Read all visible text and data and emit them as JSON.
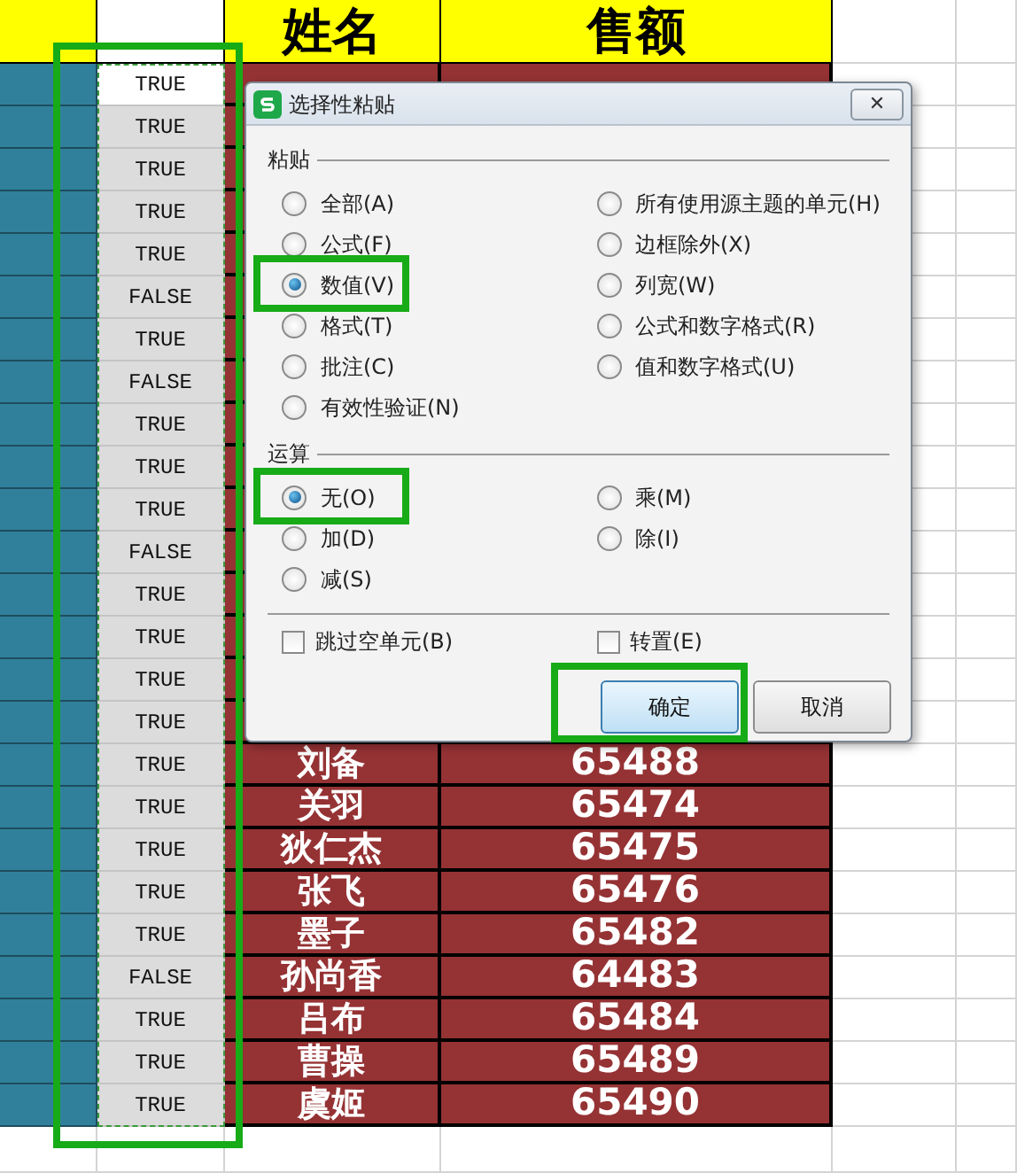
{
  "sheet": {
    "headers": [
      "姓名",
      "售额"
    ],
    "column_2_highlighted": true,
    "rows": [
      {
        "column_2": "TRUE",
        "active": true
      },
      {
        "column_2": "TRUE",
        "active": false
      },
      {
        "column_2": "TRUE",
        "active": false
      },
      {
        "column_2": "TRUE",
        "active": false
      },
      {
        "column_2": "TRUE",
        "active": false
      },
      {
        "column_2": "FALSE",
        "active": false
      },
      {
        "column_2": "TRUE",
        "active": false
      },
      {
        "column_2": "FALSE",
        "active": false
      },
      {
        "column_2": "TRUE",
        "active": false
      },
      {
        "column_2": "TRUE",
        "active": false
      },
      {
        "column_2": "TRUE",
        "active": false
      },
      {
        "column_2": "FALSE",
        "active": false
      },
      {
        "column_2": "TRUE",
        "active": false
      },
      {
        "column_2": "TRUE",
        "active": false
      },
      {
        "column_2": "TRUE",
        "active": false
      },
      {
        "column_2": "TRUE",
        "active": false
      },
      {
        "column_2": "TRUE",
        "active": false,
        "name": "刘备",
        "amount": "65488"
      },
      {
        "column_2": "TRUE",
        "active": false,
        "name": "关羽",
        "amount": "65474"
      },
      {
        "column_2": "TRUE",
        "active": false,
        "name": "狄仁杰",
        "amount": "65475"
      },
      {
        "column_2": "TRUE",
        "active": false,
        "name": "张飞",
        "amount": "65476"
      },
      {
        "column_2": "TRUE",
        "active": false,
        "name": "墨子",
        "amount": "65482"
      },
      {
        "column_2": "FALSE",
        "active": false,
        "name": "孙尚香",
        "amount": "64483"
      },
      {
        "column_2": "TRUE",
        "active": false,
        "name": "吕布",
        "amount": "65484"
      },
      {
        "column_2": "TRUE",
        "active": false,
        "name": "曹操",
        "amount": "65489"
      },
      {
        "column_2": "TRUE",
        "active": false,
        "name": "虞姬",
        "amount": "65490"
      }
    ]
  },
  "dialog": {
    "title": "选择性粘贴",
    "close": "✕",
    "paste": {
      "title": "粘贴",
      "column_1": [
        {
          "label": "全部(A)",
          "selected": false,
          "highlighted": false
        },
        {
          "label": "公式(F)",
          "selected": false,
          "highlighted": false
        },
        {
          "label": "数值(V)",
          "selected": true,
          "highlighted": true
        },
        {
          "label": "格式(T)",
          "selected": false,
          "highlighted": false
        },
        {
          "label": "批注(C)",
          "selected": false,
          "highlighted": false
        },
        {
          "label": "有效性验证(N)",
          "selected": false,
          "highlighted": false
        }
      ],
      "column_2": [
        {
          "label": "所有使用源主题的单元(H)",
          "selected": false,
          "highlighted": false
        },
        {
          "label": "边框除外(X)",
          "selected": false,
          "highlighted": false
        },
        {
          "label": "列宽(W)",
          "selected": false,
          "highlighted": false
        },
        {
          "label": "公式和数字格式(R)",
          "selected": false,
          "highlighted": false
        },
        {
          "label": "值和数字格式(U)",
          "selected": false,
          "highlighted": false
        }
      ]
    },
    "operation": {
      "title": "运算",
      "column_1": [
        {
          "label": "无(O)",
          "selected": true,
          "highlighted": true
        },
        {
          "label": "加(D)",
          "selected": false,
          "highlighted": false
        },
        {
          "label": "减(S)",
          "selected": false,
          "highlighted": false
        }
      ],
      "column_2": [
        {
          "label": "乘(M)",
          "selected": false,
          "highlighted": false
        },
        {
          "label": "除(I)",
          "selected": false,
          "highlighted": false
        }
      ]
    },
    "checkboxes": [
      {
        "label": "跳过空单元(B)",
        "checked": false
      },
      {
        "label": "转置(E)",
        "checked": false
      }
    ],
    "buttons": [
      {
        "label": "确定",
        "default": true,
        "highlighted": true
      },
      {
        "label": "取消",
        "default": false,
        "highlighted": false
      }
    ]
  }
}
